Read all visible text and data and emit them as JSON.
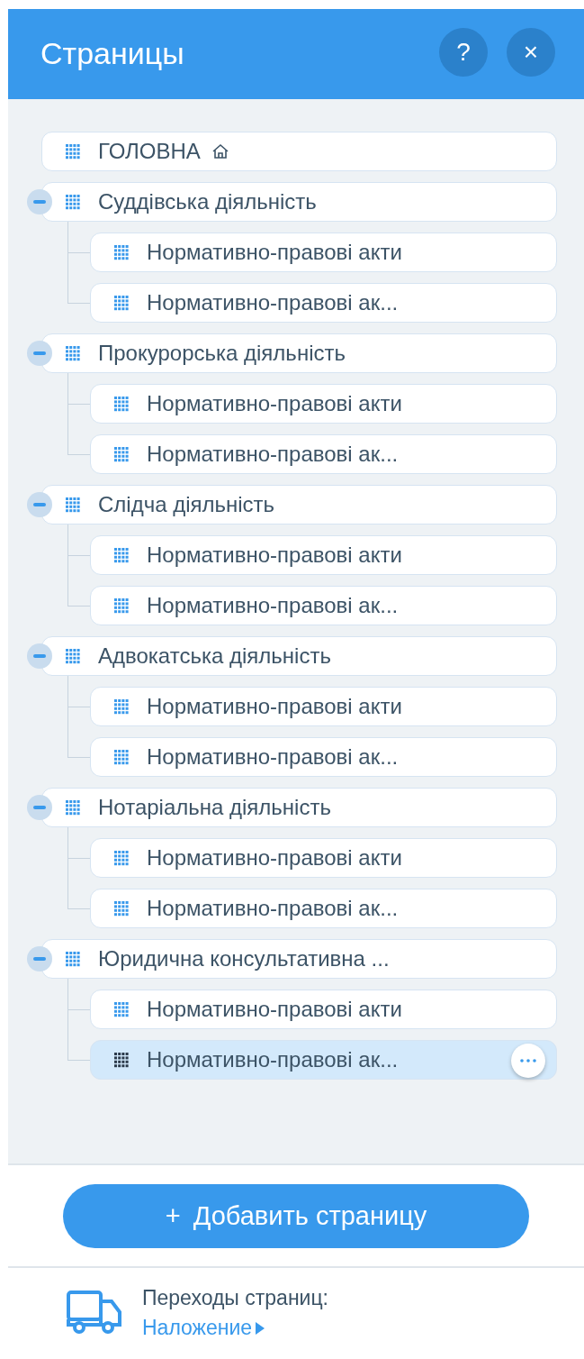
{
  "header": {
    "title": "Страницы",
    "help_button": "?",
    "close_button": "×"
  },
  "pages": [
    {
      "label": "ГОЛОВНА",
      "home": true,
      "selected": false
    },
    {
      "label": "Суддівська діяльність",
      "selected": false,
      "expanded": true,
      "children": [
        {
          "label": "Нормативно-правові акти",
          "selected": false
        },
        {
          "label": "Нормативно-правові ак...",
          "selected": false
        }
      ]
    },
    {
      "label": "Прокурорська діяльність",
      "selected": false,
      "expanded": true,
      "children": [
        {
          "label": "Нормативно-правові акти",
          "selected": false
        },
        {
          "label": "Нормативно-правові ак...",
          "selected": false
        }
      ]
    },
    {
      "label": "Слідча діяльність",
      "selected": false,
      "expanded": true,
      "children": [
        {
          "label": "Нормативно-правові акти",
          "selected": false
        },
        {
          "label": "Нормативно-правові ак...",
          "selected": false
        }
      ]
    },
    {
      "label": "Адвокатська діяльність",
      "selected": false,
      "expanded": true,
      "children": [
        {
          "label": "Нормативно-правові акти",
          "selected": false
        },
        {
          "label": "Нормативно-правові ак...",
          "selected": false
        }
      ]
    },
    {
      "label": "Нотаріальна діяльність",
      "selected": false,
      "expanded": true,
      "children": [
        {
          "label": "Нормативно-правові акти",
          "selected": false
        },
        {
          "label": "Нормативно-правові ак...",
          "selected": false
        }
      ]
    },
    {
      "label": "Юридична консультативна ...",
      "selected": false,
      "expanded": true,
      "children": [
        {
          "label": "Нормативно-правові акти",
          "selected": false
        },
        {
          "label": "Нормативно-правові ак...",
          "selected": true
        }
      ]
    }
  ],
  "add_button": {
    "icon": "+",
    "label": "Добавить страницу"
  },
  "transitions": {
    "label": "Переходы страниц:",
    "value": "Наложение"
  }
}
